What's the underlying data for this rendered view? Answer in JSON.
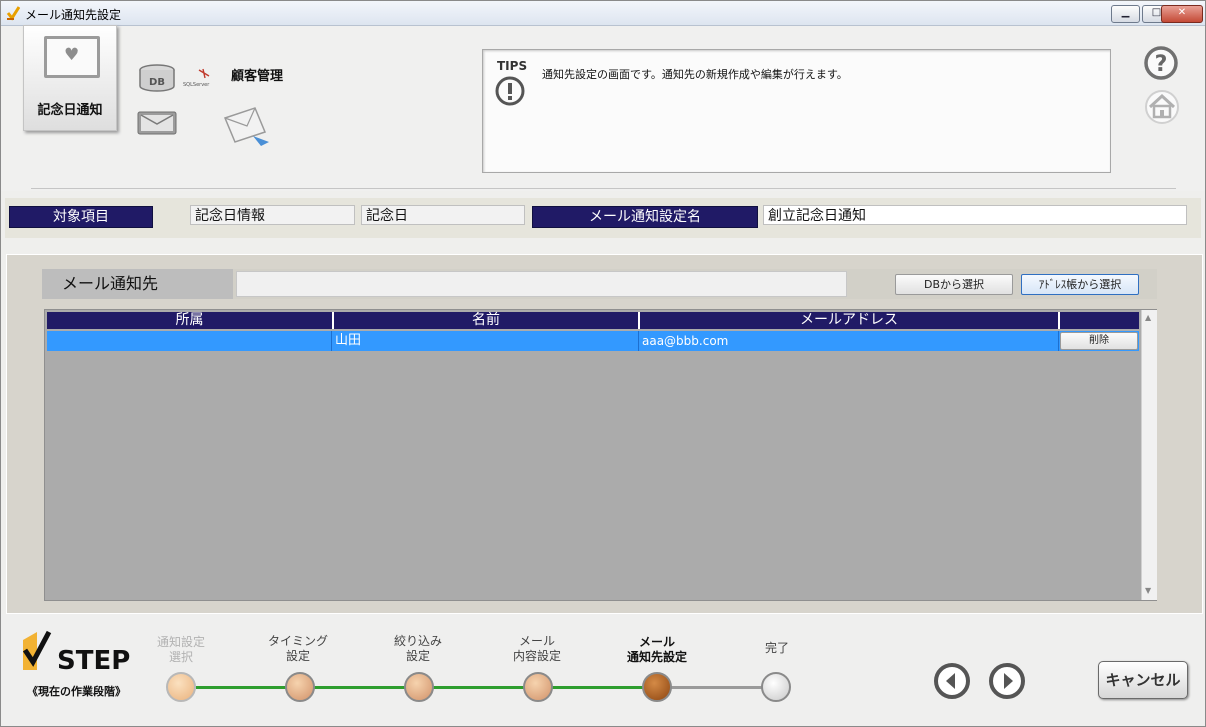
{
  "window": {
    "title": "メール通知先設定",
    "min": "▁",
    "max": "□",
    "close": "✕"
  },
  "header": {
    "tile_label": "記念日通知",
    "db_label": "DB",
    "sql_label": "SQLServer",
    "customer_label": "顧客管理",
    "tips_label": "TIPS",
    "tips_text": "通知先設定の画面です。通知先の新規作成や編集が行えます。",
    "icons": [
      "heart-icon",
      "database-icon",
      "sql-server-logo-icon",
      "mail-icon",
      "send-mail-icon",
      "exclamation-icon",
      "help-icon",
      "home-icon"
    ]
  },
  "info": {
    "target_label": "対象項目",
    "target_value1": "記念日情報",
    "target_value2": "記念日",
    "setting_label": "メール通知設定名",
    "setting_value": "創立記念日通知"
  },
  "notify": {
    "title": "メール通知先",
    "field_value": "",
    "db_button": "DBから選択",
    "addr_button": "ｱﾄﾞﾚｽ帳から選択",
    "columns": [
      "所属",
      "名前",
      "メールアドレス",
      ""
    ],
    "rows": [
      {
        "dept": "",
        "name": "山田",
        "email": "aaa@bbb.com",
        "action": "削除"
      }
    ]
  },
  "steps": {
    "logo": "STEP",
    "sub": "《現在の作業段階》",
    "items": [
      {
        "label": "通知設定\n選択"
      },
      {
        "label": "タイミング\n設定"
      },
      {
        "label": "絞り込み\n設定"
      },
      {
        "label": "メール\n内容設定"
      },
      {
        "label": "メール\n通知先設定"
      },
      {
        "label": "完了"
      }
    ],
    "prev": "◀",
    "next": "▶",
    "cancel": "キャンセル"
  },
  "colors": {
    "navy": "#201a66",
    "selected_row": "#3399ff",
    "progress_green": "#2e9e2e",
    "step_done": "#e9bd8c",
    "step_current": "#a45a1c"
  }
}
